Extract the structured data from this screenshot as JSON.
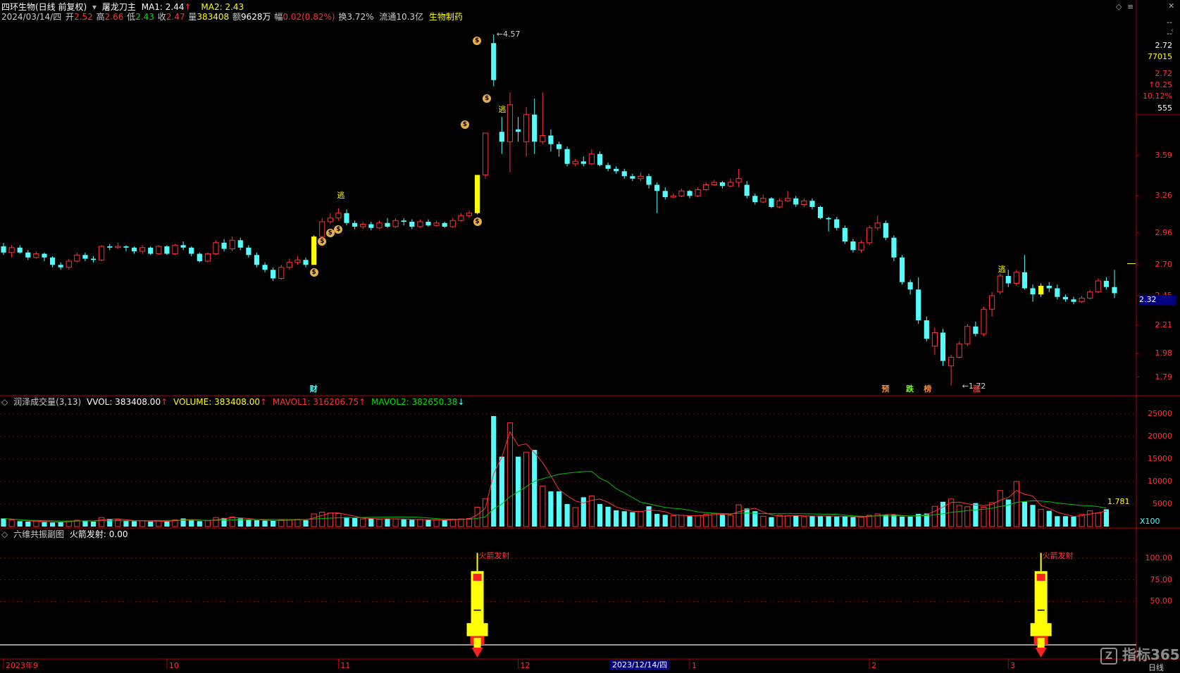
{
  "colors": {
    "up": "#ff3232",
    "down": "#54fcfc",
    "signal": "#ffff00",
    "grid": "#8b0000",
    "ma_green": "#00c000",
    "ma_yellow": "#ffff00",
    "text_white": "#ffffff"
  },
  "header": {
    "stock": "四环生物(日线 前复权)",
    "indicator": "屠龙刀主",
    "ma1_label": "MA1: 2.44",
    "ma1_arrow": "↑",
    "ma2_label": "MA2: 2.43",
    "line2": {
      "date": "2024/03/14/四",
      "open_lbl": "开",
      "open": "2.52",
      "high_lbl": "高",
      "high": "2.66",
      "low_lbl": "低",
      "low": "2.43",
      "close_lbl": "收",
      "close": "2.47",
      "vol_lbl": "量",
      "vol": "383408",
      "amt_lbl": "额",
      "amt": "9628万",
      "chg_lbl": "幅",
      "chg": "0.02(0.82%)",
      "turn": "换3.72%",
      "float": "流通10.3亿",
      "sector": "生物制药"
    }
  },
  "right_panel": {
    "top": "--",
    "mid": "--",
    "price": "2.72",
    "vol": "77015",
    "price2": "2.72",
    "change": "↑0.25",
    "pct": "10.12%",
    "count": "555"
  },
  "price_axis": [
    "3.59",
    "3.26",
    "2.96",
    "2.70",
    "2.45",
    "2.21",
    "1.98",
    "1.79"
  ],
  "current_price_tag": "2.32",
  "annotations": {
    "high": "4.57",
    "low": "1.72",
    "escape": "逃",
    "coin": "$",
    "cai": "财",
    "yu": "预",
    "die": "跌",
    "bang": "榜",
    "zhang": "涨",
    "rocket_text": "火箭发射"
  },
  "vol_panel": {
    "title": "润泽成交量(3,13)",
    "vvol": "VVOL: 383408.00",
    "vvol_arrow": "↑",
    "volume": "VOLUME: 383408.00",
    "volume_arrow": "↑",
    "mavol1": "MAVOL1: 316206.75",
    "mavol1_arrow": "↑",
    "mavol2": "MAVOL2: 382650.38",
    "mavol2_arrow": "↓",
    "axis": [
      "25000",
      "20000",
      "15000",
      "10000",
      "5000"
    ],
    "unit": "X100",
    "last": "1.781"
  },
  "sub_panel": {
    "title": "六维共振副图",
    "value": "火箭发射: 0.00",
    "axis": [
      "100.00",
      "75.00",
      "50.00"
    ]
  },
  "x_axis": {
    "labels": [
      "2023年9",
      "10",
      "11",
      "12",
      "1",
      "2",
      "3"
    ],
    "cursor": "2023/12/14/四",
    "period": "日线"
  },
  "watermark": "指标365",
  "chart_data": {
    "type": "candlestick",
    "price_ylim": [
      1.65,
      4.65
    ],
    "candles": [
      [
        2.85,
        2.8,
        2.88,
        2.78
      ],
      [
        2.8,
        2.84,
        2.86,
        2.76
      ],
      [
        2.84,
        2.8,
        2.86,
        2.79
      ],
      [
        2.8,
        2.76,
        2.82,
        2.74
      ],
      [
        2.76,
        2.79,
        2.81,
        2.75
      ],
      [
        2.79,
        2.76,
        2.8,
        2.73
      ],
      [
        2.76,
        2.7,
        2.77,
        2.68
      ],
      [
        2.7,
        2.68,
        2.72,
        2.66
      ],
      [
        2.68,
        2.73,
        2.75,
        2.66
      ],
      [
        2.73,
        2.78,
        2.8,
        2.72
      ],
      [
        2.78,
        2.75,
        2.8,
        2.73
      ],
      [
        2.75,
        2.74,
        2.77,
        2.72
      ],
      [
        2.74,
        2.85,
        2.86,
        2.73
      ],
      [
        2.85,
        2.84,
        2.87,
        2.82
      ],
      [
        2.84,
        2.85,
        2.88,
        2.83
      ],
      [
        2.85,
        2.84,
        2.86,
        2.81
      ],
      [
        2.84,
        2.81,
        2.85,
        2.79
      ],
      [
        2.81,
        2.84,
        2.86,
        2.79
      ],
      [
        2.84,
        2.79,
        2.85,
        2.78
      ],
      [
        2.79,
        2.85,
        2.86,
        2.78
      ],
      [
        2.85,
        2.79,
        2.86,
        2.78
      ],
      [
        2.79,
        2.86,
        2.87,
        2.78
      ],
      [
        2.86,
        2.84,
        2.89,
        2.82
      ],
      [
        2.84,
        2.79,
        2.85,
        2.77
      ],
      [
        2.79,
        2.73,
        2.8,
        2.72
      ],
      [
        2.73,
        2.79,
        2.8,
        2.72
      ],
      [
        2.79,
        2.88,
        2.9,
        2.78
      ],
      [
        2.88,
        2.83,
        2.91,
        2.81
      ],
      [
        2.83,
        2.9,
        2.93,
        2.81
      ],
      [
        2.9,
        2.84,
        2.92,
        2.82
      ],
      [
        2.84,
        2.78,
        2.86,
        2.76
      ],
      [
        2.78,
        2.7,
        2.8,
        2.68
      ],
      [
        2.7,
        2.66,
        2.72,
        2.64
      ],
      [
        2.66,
        2.59,
        2.68,
        2.57
      ],
      [
        2.59,
        2.68,
        2.7,
        2.58
      ],
      [
        2.68,
        2.72,
        2.75,
        2.66
      ],
      [
        2.72,
        2.74,
        2.77,
        2.7
      ],
      [
        2.74,
        2.7,
        2.76,
        2.68
      ],
      [
        2.7,
        2.93,
        2.94,
        2.7
      ],
      [
        2.93,
        3.05,
        3.08,
        2.92
      ],
      [
        3.05,
        3.08,
        3.12,
        3.03
      ],
      [
        3.08,
        3.12,
        3.16,
        3.06
      ],
      [
        3.12,
        3.04,
        3.15,
        3.02
      ],
      [
        3.04,
        3.01,
        3.06,
        2.99
      ],
      [
        3.01,
        3.03,
        3.05,
        2.99
      ],
      [
        3.03,
        3.0,
        3.05,
        2.98
      ],
      [
        3.0,
        3.04,
        3.06,
        2.99
      ],
      [
        3.04,
        3.01,
        3.08,
        3.0
      ],
      [
        3.01,
        3.06,
        3.08,
        3.0
      ],
      [
        3.06,
        3.05,
        3.08,
        3.02
      ],
      [
        3.05,
        3.01,
        3.07,
        2.99
      ],
      [
        3.01,
        3.05,
        3.07,
        3.0
      ],
      [
        3.05,
        3.02,
        3.07,
        3.01
      ],
      [
        3.02,
        3.04,
        3.06,
        3.01
      ],
      [
        3.04,
        3.01,
        3.05,
        3.0
      ],
      [
        3.01,
        3.06,
        3.08,
        3.0
      ],
      [
        3.06,
        3.1,
        3.12,
        3.05
      ],
      [
        3.1,
        3.12,
        3.14,
        3.08
      ],
      [
        3.12,
        3.43,
        3.43,
        3.11
      ],
      [
        3.43,
        3.77,
        3.77,
        3.4
      ],
      [
        4.5,
        4.2,
        4.57,
        4.15
      ],
      [
        3.78,
        3.7,
        3.9,
        3.6
      ],
      [
        3.7,
        4.0,
        4.1,
        3.45
      ],
      [
        3.8,
        3.78,
        3.9,
        3.7
      ],
      [
        3.7,
        3.92,
        3.98,
        3.58
      ],
      [
        3.92,
        3.7,
        4.05,
        3.6
      ],
      [
        3.7,
        3.75,
        4.1,
        3.68
      ],
      [
        3.75,
        3.68,
        3.8,
        3.62
      ],
      [
        3.68,
        3.64,
        3.7,
        3.58
      ],
      [
        3.64,
        3.52,
        3.66,
        3.5
      ],
      [
        3.52,
        3.54,
        3.56,
        3.5
      ],
      [
        3.54,
        3.52,
        3.58,
        3.5
      ],
      [
        3.52,
        3.6,
        3.64,
        3.51
      ],
      [
        3.6,
        3.51,
        3.62,
        3.5
      ],
      [
        3.51,
        3.48,
        3.53,
        3.46
      ],
      [
        3.48,
        3.46,
        3.5,
        3.44
      ],
      [
        3.46,
        3.42,
        3.48,
        3.4
      ],
      [
        3.42,
        3.4,
        3.44,
        3.38
      ],
      [
        3.4,
        3.42,
        3.45,
        3.38
      ],
      [
        3.42,
        3.35,
        3.44,
        3.32
      ],
      [
        3.35,
        3.3,
        3.37,
        3.12
      ],
      [
        3.3,
        3.25,
        3.33,
        3.23
      ],
      [
        3.25,
        3.26,
        3.28,
        3.24
      ],
      [
        3.26,
        3.3,
        3.32,
        3.25
      ],
      [
        3.3,
        3.26,
        3.31,
        3.24
      ],
      [
        3.26,
        3.31,
        3.33,
        3.25
      ],
      [
        3.31,
        3.35,
        3.37,
        3.3
      ],
      [
        3.35,
        3.37,
        3.39,
        3.34
      ],
      [
        3.37,
        3.34,
        3.38,
        3.32
      ],
      [
        3.34,
        3.37,
        3.4,
        3.33
      ],
      [
        3.37,
        3.4,
        3.48,
        3.33
      ],
      [
        3.35,
        3.26,
        3.38,
        3.24
      ],
      [
        3.26,
        3.21,
        3.28,
        3.19
      ],
      [
        3.21,
        3.24,
        3.27,
        3.2
      ],
      [
        3.24,
        3.17,
        3.25,
        3.16
      ],
      [
        3.17,
        3.22,
        3.24,
        3.16
      ],
      [
        3.22,
        3.24,
        3.3,
        3.21
      ],
      [
        3.24,
        3.19,
        3.26,
        3.17
      ],
      [
        3.19,
        3.22,
        3.24,
        3.17
      ],
      [
        3.22,
        3.17,
        3.24,
        3.15
      ],
      [
        3.17,
        3.08,
        3.18,
        3.07
      ],
      [
        3.08,
        3.07,
        3.09,
        2.97
      ],
      [
        3.07,
        3.0,
        3.09,
        2.98
      ],
      [
        3.0,
        2.89,
        3.02,
        2.87
      ],
      [
        2.89,
        2.82,
        2.91,
        2.8
      ],
      [
        2.82,
        2.88,
        2.9,
        2.8
      ],
      [
        2.88,
        3.0,
        3.02,
        2.86
      ],
      [
        3.0,
        3.04,
        3.1,
        2.98
      ],
      [
        3.04,
        2.92,
        3.06,
        2.9
      ],
      [
        2.92,
        2.76,
        2.94,
        2.73
      ],
      [
        2.76,
        2.56,
        2.78,
        2.54
      ],
      [
        2.56,
        2.5,
        2.58,
        2.46
      ],
      [
        2.5,
        2.25,
        2.6,
        2.22
      ],
      [
        2.25,
        2.1,
        2.28,
        2.08
      ],
      [
        2.04,
        2.15,
        2.19,
        1.97
      ],
      [
        2.15,
        1.92,
        2.18,
        1.88
      ],
      [
        1.88,
        1.95,
        1.97,
        1.72
      ],
      [
        1.95,
        2.06,
        2.08,
        1.94
      ],
      [
        2.06,
        2.2,
        2.22,
        2.04
      ],
      [
        2.2,
        2.14,
        2.24,
        2.12
      ],
      [
        2.14,
        2.34,
        2.36,
        2.12
      ],
      [
        2.34,
        2.45,
        2.48,
        2.28
      ],
      [
        2.48,
        2.61,
        2.63,
        2.46
      ],
      [
        2.61,
        2.55,
        2.66,
        2.52
      ],
      [
        2.55,
        2.64,
        2.66,
        2.53
      ],
      [
        2.64,
        2.51,
        2.78,
        2.5
      ],
      [
        2.51,
        2.46,
        2.54,
        2.4
      ],
      [
        2.46,
        2.53,
        2.55,
        2.44
      ],
      [
        2.53,
        2.51,
        2.56,
        2.48
      ],
      [
        2.51,
        2.44,
        2.54,
        2.42
      ],
      [
        2.44,
        2.42,
        2.46,
        2.4
      ],
      [
        2.42,
        2.4,
        2.44,
        2.38
      ],
      [
        2.4,
        2.43,
        2.45,
        2.39
      ],
      [
        2.43,
        2.48,
        2.5,
        2.42
      ],
      [
        2.48,
        2.57,
        2.59,
        2.47
      ],
      [
        2.57,
        2.52,
        2.6,
        2.5
      ],
      [
        2.52,
        2.47,
        2.66,
        2.43
      ]
    ],
    "volume": [
      1800,
      1500,
      1200,
      1100,
      1300,
      1000,
      900,
      1100,
      1200,
      1400,
      1300,
      1100,
      2000,
      1700,
      1500,
      1300,
      1200,
      1300,
      1100,
      1300,
      1100,
      1500,
      1800,
      1400,
      1200,
      1300,
      2000,
      1900,
      2100,
      1800,
      1500,
      1400,
      1300,
      1300,
      1400,
      1500,
      1600,
      1400,
      2800,
      3200,
      3000,
      2900,
      2100,
      1900,
      1700,
      1800,
      1600,
      1800,
      1700,
      1600,
      1500,
      1600,
      1500,
      1500,
      1400,
      1600,
      1700,
      1800,
      4300,
      6200,
      24500,
      15500,
      23000,
      15500,
      16500,
      17000,
      9000,
      7800,
      7800,
      5000,
      4200,
      6500,
      6800,
      5000,
      4400,
      3600,
      3400,
      3200,
      3300,
      4500,
      2800,
      2600,
      2400,
      2500,
      2300,
      2400,
      2700,
      2900,
      2600,
      2500,
      4800,
      4000,
      3400,
      2300,
      2100,
      2500,
      2400,
      2500,
      2200,
      2300,
      2400,
      2300,
      2200,
      2300,
      2100,
      2100,
      2500,
      2800,
      2600,
      2600,
      2200,
      2200,
      2800,
      2900,
      4500,
      5500,
      6100,
      4700,
      4400,
      5200,
      4300,
      5300,
      8000,
      6000,
      10000,
      5500,
      4800,
      3800,
      3500,
      2300,
      2300,
      2200,
      2700,
      3500,
      3000,
      3834
    ],
    "vol_ylim": [
      0,
      27000
    ],
    "rocket_level": 100,
    "sub_ylim": [
      0,
      125
    ]
  }
}
